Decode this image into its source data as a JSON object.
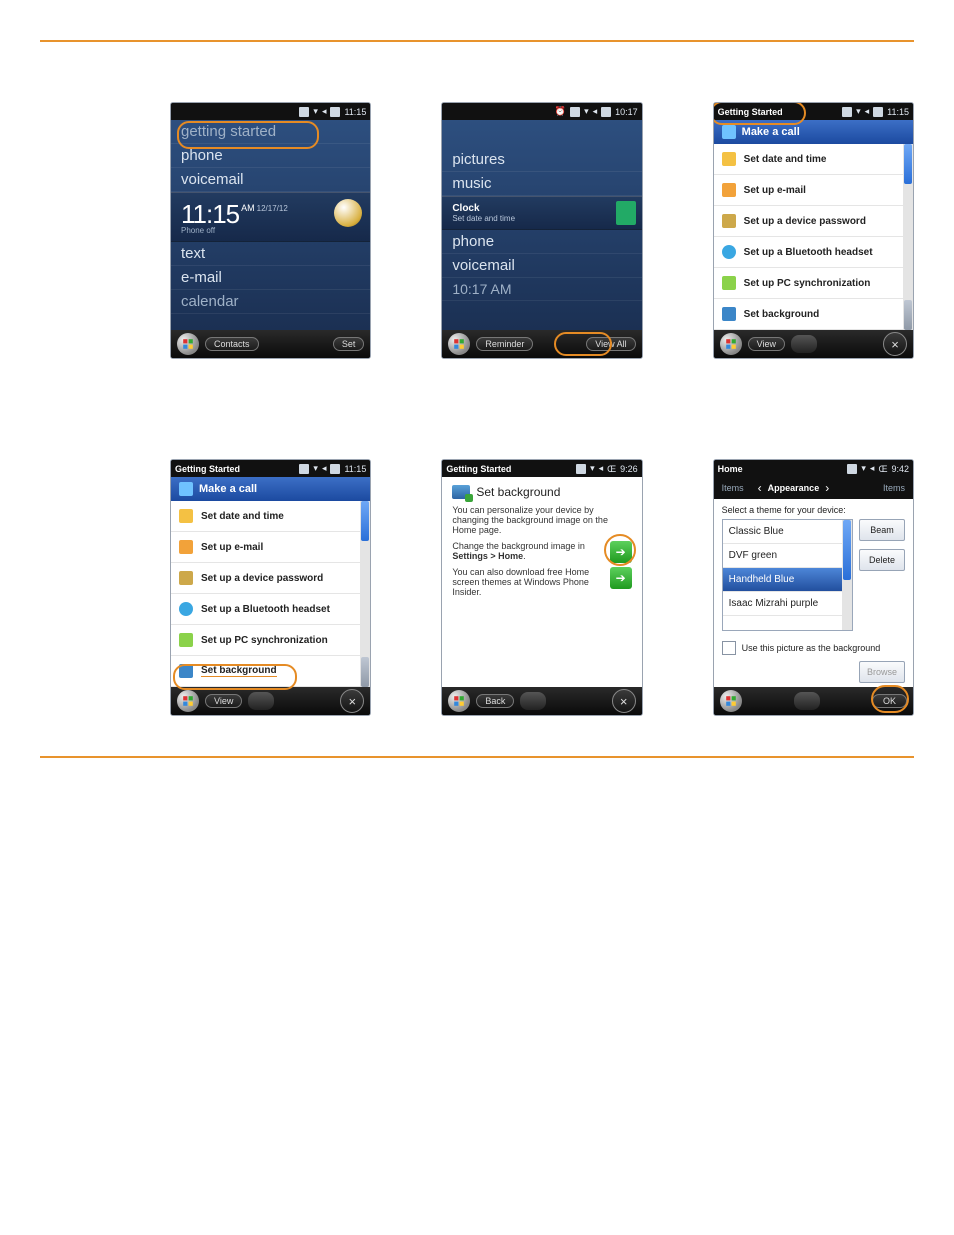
{
  "hr": "orange",
  "row1": {
    "d1": {
      "time": "11:15",
      "items": [
        "getting started",
        "phone",
        "voicemail"
      ],
      "clock": {
        "big": "11:15",
        "ampm": "AM",
        "date": "12/17/12",
        "sub": "Phone off"
      },
      "below": [
        "text",
        "e-mail",
        "calendar"
      ],
      "soft": {
        "left": "Contacts",
        "right": "Set"
      }
    },
    "d2": {
      "time": "10:17",
      "itemsTop": [
        "pictures",
        "music"
      ],
      "clock": {
        "label": "Clock",
        "sub": "Set date and time"
      },
      "itemsMid": [
        "phone",
        "voicemail",
        "10:17 AM"
      ],
      "soft": {
        "left": "Reminder",
        "right": "View All"
      }
    },
    "d3": {
      "app": "Getting Started",
      "time": "11:15",
      "head": "Make a call",
      "items": [
        "Set date and time",
        "Set up e-mail",
        "Set up a device password",
        "Set up a Bluetooth headset",
        "Set up PC synchronization",
        "Set background"
      ],
      "soft": {
        "left": "View"
      }
    }
  },
  "row2": {
    "d4": {
      "app": "Getting Started",
      "time": "11:15",
      "head": "Make a call",
      "items": [
        "Set date and time",
        "Set up e-mail",
        "Set up a device password",
        "Set up a Bluetooth headset",
        "Set up PC synchronization",
        "Set background"
      ],
      "soft": {
        "left": "View"
      }
    },
    "d5": {
      "app": "Getting Started",
      "time": "9:26",
      "title": "Set background",
      "p1": "You can personalize your device by changing the background image on the Home page.",
      "p2a": "Change the background image in ",
      "p2b": "Settings > Home",
      "p2c": ".",
      "p3": "You can also download free Home screen themes at Windows Phone Insider.",
      "soft": {
        "left": "Back"
      }
    },
    "d6": {
      "app": "Home",
      "time": "9:42",
      "tabs": {
        "left": "Items",
        "mid": "Appearance",
        "right": "Items"
      },
      "prompt": "Select a theme for your device:",
      "opts": [
        "Classic Blue",
        "DVF green",
        "Handheld Blue",
        "Isaac Mizrahi purple"
      ],
      "sel": 2,
      "btns": {
        "beam": "Beam",
        "del": "Delete"
      },
      "chk": "Use this picture as the background",
      "browse": "Browse",
      "soft": {
        "right": "OK"
      }
    }
  }
}
